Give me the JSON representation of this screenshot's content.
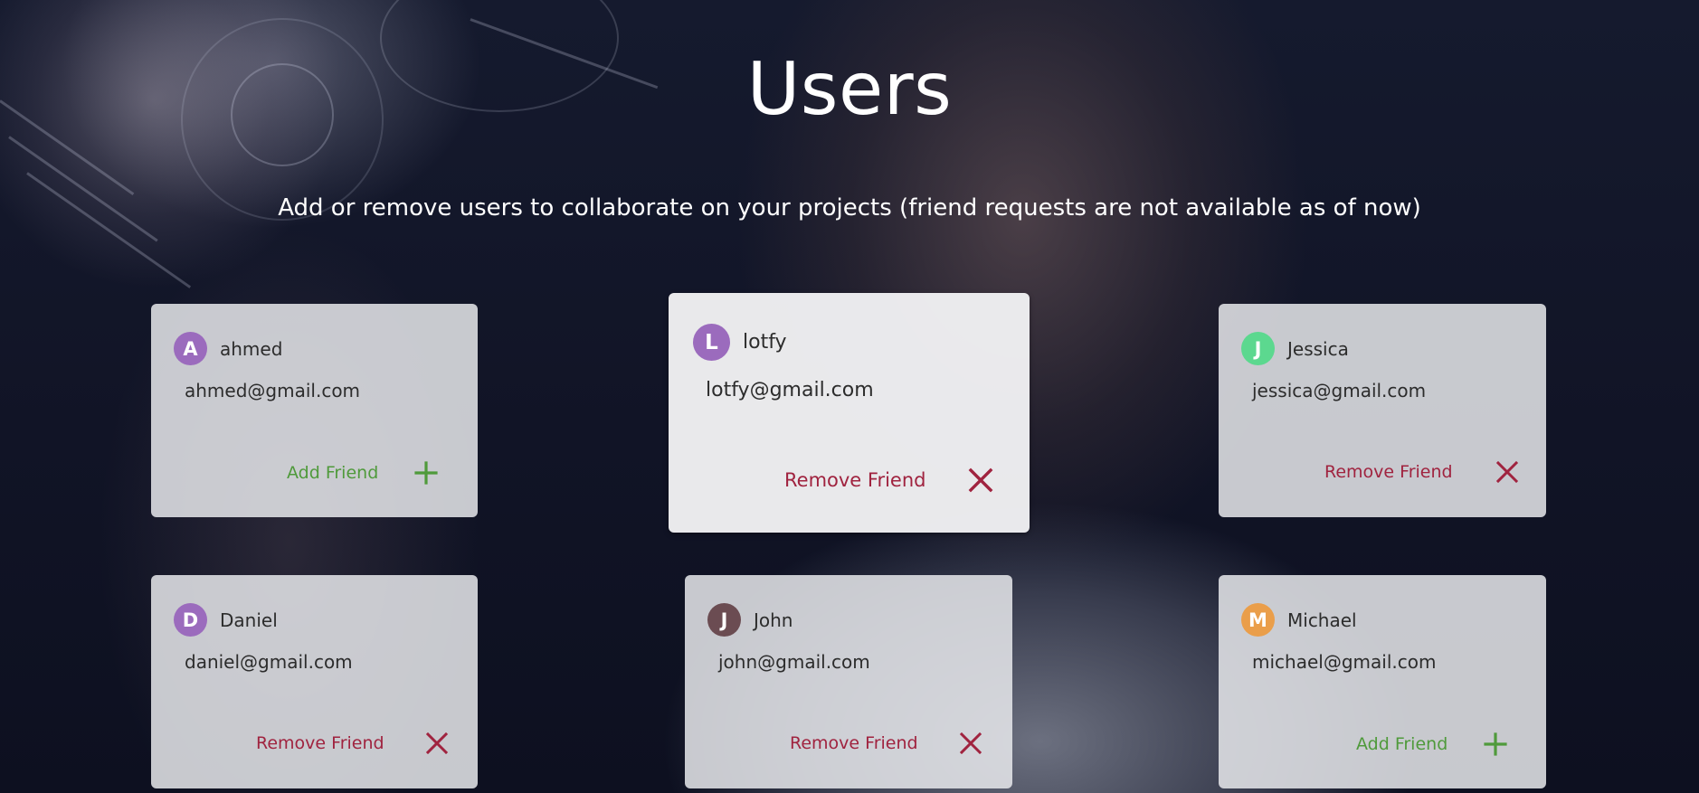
{
  "header": {
    "title": "Users",
    "subtitle": "Add or remove users to collaborate on your projects (friend requests are not available as of now)"
  },
  "colors": {
    "add": "#4f9a3b",
    "remove": "#a0233f"
  },
  "users": [
    {
      "initial": "A",
      "name": "ahmed",
      "email": "ahmed@gmail.com",
      "avatar_color": "#9b6bbd",
      "action": "Add Friend",
      "action_type": "add"
    },
    {
      "initial": "L",
      "name": "lotfy",
      "email": "lotfy@gmail.com",
      "avatar_color": "#9b6bbd",
      "action": "Remove Friend",
      "action_type": "remove"
    },
    {
      "initial": "J",
      "name": "Jessica",
      "email": "jessica@gmail.com",
      "avatar_color": "#5cd88f",
      "action": "Remove Friend",
      "action_type": "remove"
    },
    {
      "initial": "D",
      "name": "Daniel",
      "email": "daniel@gmail.com",
      "avatar_color": "#9b6bbd",
      "action": "Remove Friend",
      "action_type": "remove"
    },
    {
      "initial": "J",
      "name": "John",
      "email": "john@gmail.com",
      "avatar_color": "#6b4c52",
      "action": "Remove Friend",
      "action_type": "remove"
    },
    {
      "initial": "M",
      "name": "Michael",
      "email": "michael@gmail.com",
      "avatar_color": "#ea9e4a",
      "action": "Add Friend",
      "action_type": "add"
    }
  ]
}
